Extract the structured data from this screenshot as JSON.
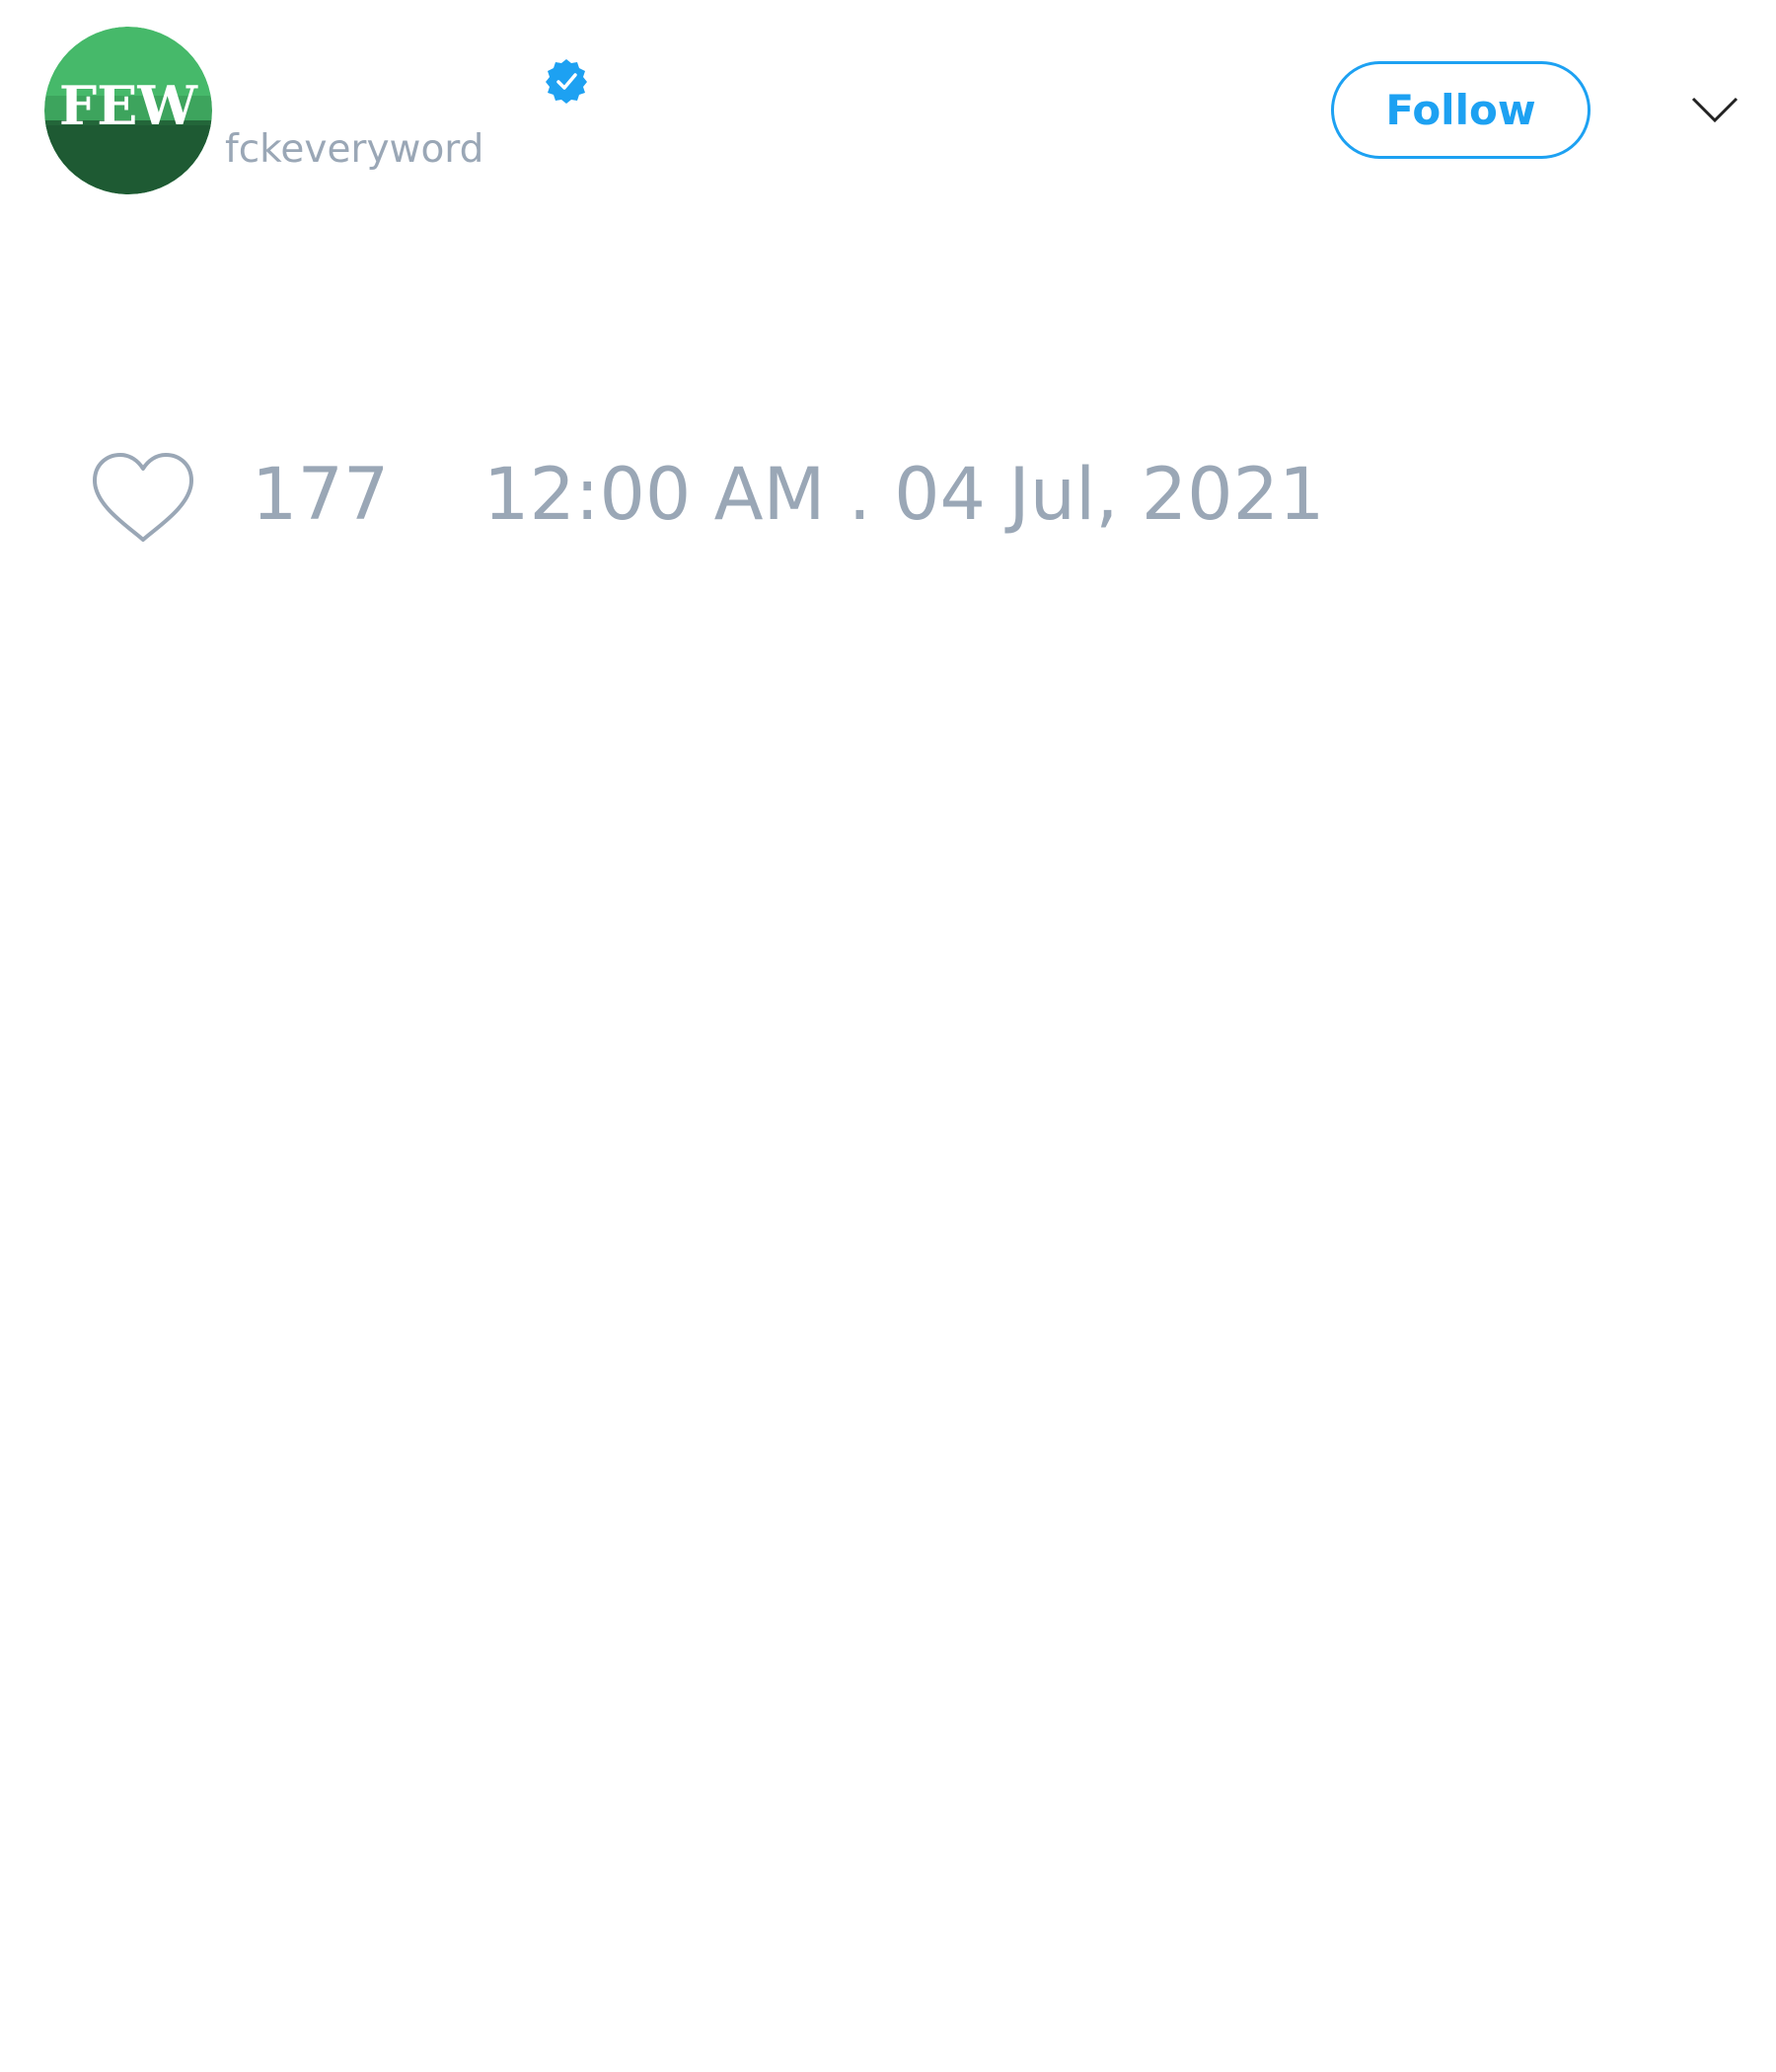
{
  "user": {
    "handle": "fckeveryword",
    "avatar_text": "FEW",
    "verified": true
  },
  "actions": {
    "follow_label": "Follow",
    "menu_icon": "chevron-down-icon"
  },
  "stats": {
    "like_icon": "heart-icon",
    "likes": "177",
    "timestamp": "12:00 AM . 04 Jul, 2021"
  },
  "colors": {
    "accent": "#1da1f2",
    "muted_text": "#9aa7b6",
    "avatar_green_light": "#46b96a",
    "avatar_green_dark": "#1e5a33"
  }
}
